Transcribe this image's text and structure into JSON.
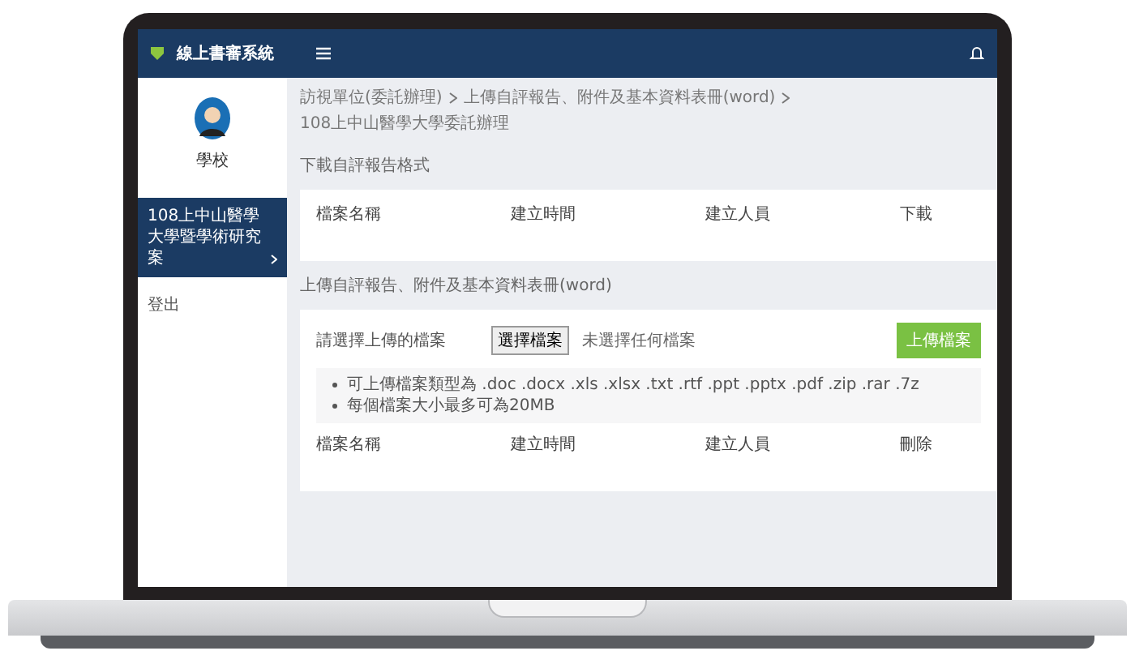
{
  "header": {
    "title": "線上書審系統"
  },
  "sidebar": {
    "user": "學校",
    "items": [
      {
        "label": "108上中山醫學大學暨學術研究案",
        "selected": true
      },
      {
        "label": "登出",
        "selected": false
      }
    ]
  },
  "breadcrumb": [
    "訪視單位(委託辦理)",
    "上傳自評報告、附件及基本資料表冊(word)",
    "108上中山醫學大學委託辦理"
  ],
  "download": {
    "title": "下載自評報告格式",
    "columns": [
      "檔案名稱",
      "建立時間",
      "建立人員",
      "下載"
    ]
  },
  "upload": {
    "title": "上傳自評報告、附件及基本資料表冊(word)",
    "field_label": "請選擇上傳的檔案",
    "choose_button": "選擇檔案",
    "no_file": "未選擇任何檔案",
    "submit": "上傳檔案",
    "notes": [
      "可上傳檔案類型為 .doc .docx .xls .xlsx .txt .rtf .ppt .pptx .pdf .zip .rar .7z",
      "每個檔案大小最多可為20MB"
    ],
    "columns": [
      "檔案名稱",
      "建立時間",
      "建立人員",
      "刪除"
    ]
  }
}
